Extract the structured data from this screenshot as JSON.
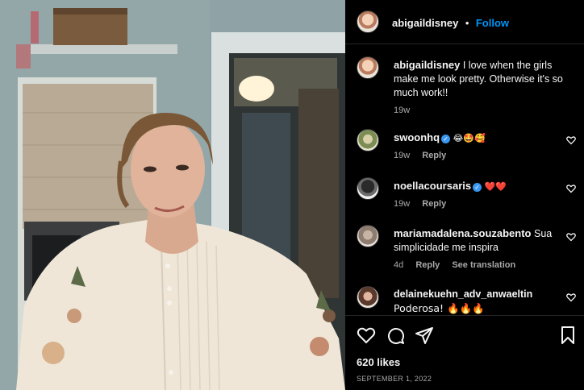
{
  "post": {
    "author": "abigaildisney",
    "follow_label": "Follow",
    "separator": "•",
    "caption": "I love when the girls make me look pretty. Otherwise it's so much work!!",
    "caption_time": "19w",
    "likes": "620 likes",
    "date": "SEPTEMBER 1, 2022"
  },
  "comments": [
    {
      "user": "swoonhq",
      "verified": true,
      "text": "😂🤩🥰",
      "time": "19w",
      "reply": "Reply",
      "translate": ""
    },
    {
      "user": "noellacoursaris",
      "verified": true,
      "text": "❤️❤️",
      "time": "19w",
      "reply": "Reply",
      "translate": ""
    },
    {
      "user": "mariamadalena.souzabento",
      "verified": false,
      "text": "Sua simplicidade me inspira",
      "time": "4d",
      "reply": "Reply",
      "translate": "See translation"
    },
    {
      "user": "delainekuehn_adv_anwaeltin",
      "verified": false,
      "text": "Poderosa! 🔥🔥🔥",
      "time": "",
      "reply": "",
      "translate": ""
    }
  ],
  "icons": {
    "like": "heart-icon",
    "comment": "comment-icon",
    "share": "share-icon",
    "save": "bookmark-icon"
  }
}
